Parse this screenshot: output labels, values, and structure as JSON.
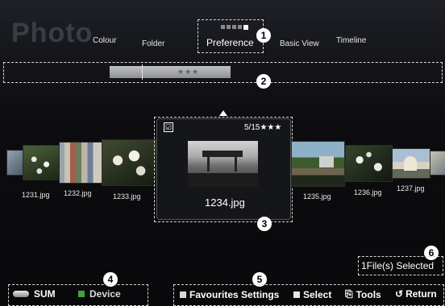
{
  "header": {
    "title": "Photo",
    "tabs": [
      {
        "label": "Colour"
      },
      {
        "label": "Folder"
      },
      {
        "label": "Preference"
      },
      {
        "label": "Basic View"
      },
      {
        "label": "Timeline"
      }
    ],
    "active_tab": "Preference"
  },
  "rating_filter": {
    "stars": "★★★"
  },
  "thumbnails": [
    {
      "name": "1231.jpg"
    },
    {
      "name": "1232.jpg"
    },
    {
      "name": "1233.jpg"
    },
    {
      "name": "1234.jpg"
    },
    {
      "name": "1235.jpg"
    },
    {
      "name": "1236.jpg"
    },
    {
      "name": "1237.jpg"
    }
  ],
  "selected_item": {
    "name": "1234.jpg",
    "position": "5/15",
    "rating": "★★★",
    "checked": "☑"
  },
  "status": {
    "selected_text": "1File(s) Selected"
  },
  "footer": {
    "sum_label": "SUM",
    "device_label": "Device",
    "favourites_label": "Favourites Settings",
    "select_label": "Select",
    "tools_label": "Tools",
    "return_label": "Return"
  },
  "callouts": [
    "1",
    "2",
    "3",
    "4",
    "5",
    "6"
  ],
  "colors": {
    "device_button": "#3ea43e",
    "favourites_button": "#d9d9d9",
    "select_button": "#e6e6e6",
    "rating_bar": "#a7a9ac"
  }
}
